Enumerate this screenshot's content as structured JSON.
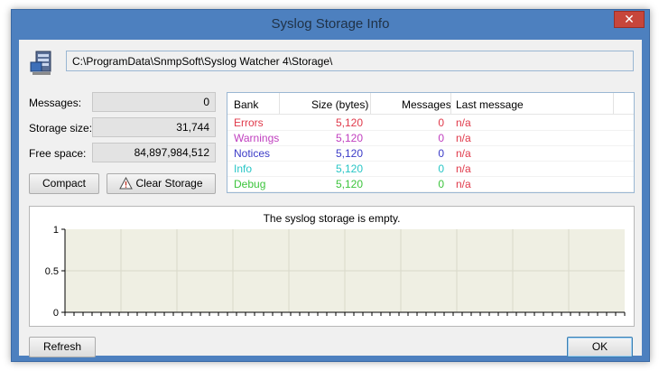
{
  "window": {
    "title": "Syslog Storage Info",
    "close_glyph": "✕"
  },
  "storage_path": "C:\\ProgramData\\SnmpSoft\\Syslog Watcher 4\\Storage\\",
  "stats": {
    "messages_label": "Messages:",
    "messages_value": "0",
    "size_label": "Storage size:",
    "size_value": "31,744",
    "free_label": "Free space:",
    "free_value": "84,897,984,512"
  },
  "buttons": {
    "compact": "Compact",
    "clear": "Clear Storage",
    "refresh": "Refresh",
    "ok": "OK"
  },
  "bank_table": {
    "headers": [
      "Bank",
      "Size (bytes)",
      "Messages",
      "Last message"
    ],
    "rows": [
      {
        "bank": "Errors",
        "size": "5,120",
        "messages": "0",
        "last": "n/a",
        "color": "#e0394a"
      },
      {
        "bank": "Warnings",
        "size": "5,120",
        "messages": "0",
        "last": "n/a",
        "color": "#c03fbf"
      },
      {
        "bank": "Notices",
        "size": "5,120",
        "messages": "0",
        "last": "n/a",
        "color": "#3b3bc7"
      },
      {
        "bank": "Info",
        "size": "5,120",
        "messages": "0",
        "last": "n/a",
        "color": "#28c6c6"
      },
      {
        "bank": "Debug",
        "size": "5,120",
        "messages": "0",
        "last": "n/a",
        "color": "#3cc43c"
      }
    ]
  },
  "chart": {
    "title": "The syslog storage is empty.",
    "y_ticks": [
      "1",
      "0.5",
      "0"
    ],
    "plot_bg": "#efefe3",
    "grid_color": "#d9d9c9"
  },
  "icons": {
    "storage": "database-server-icon",
    "warning": "warning-triangle-icon"
  }
}
